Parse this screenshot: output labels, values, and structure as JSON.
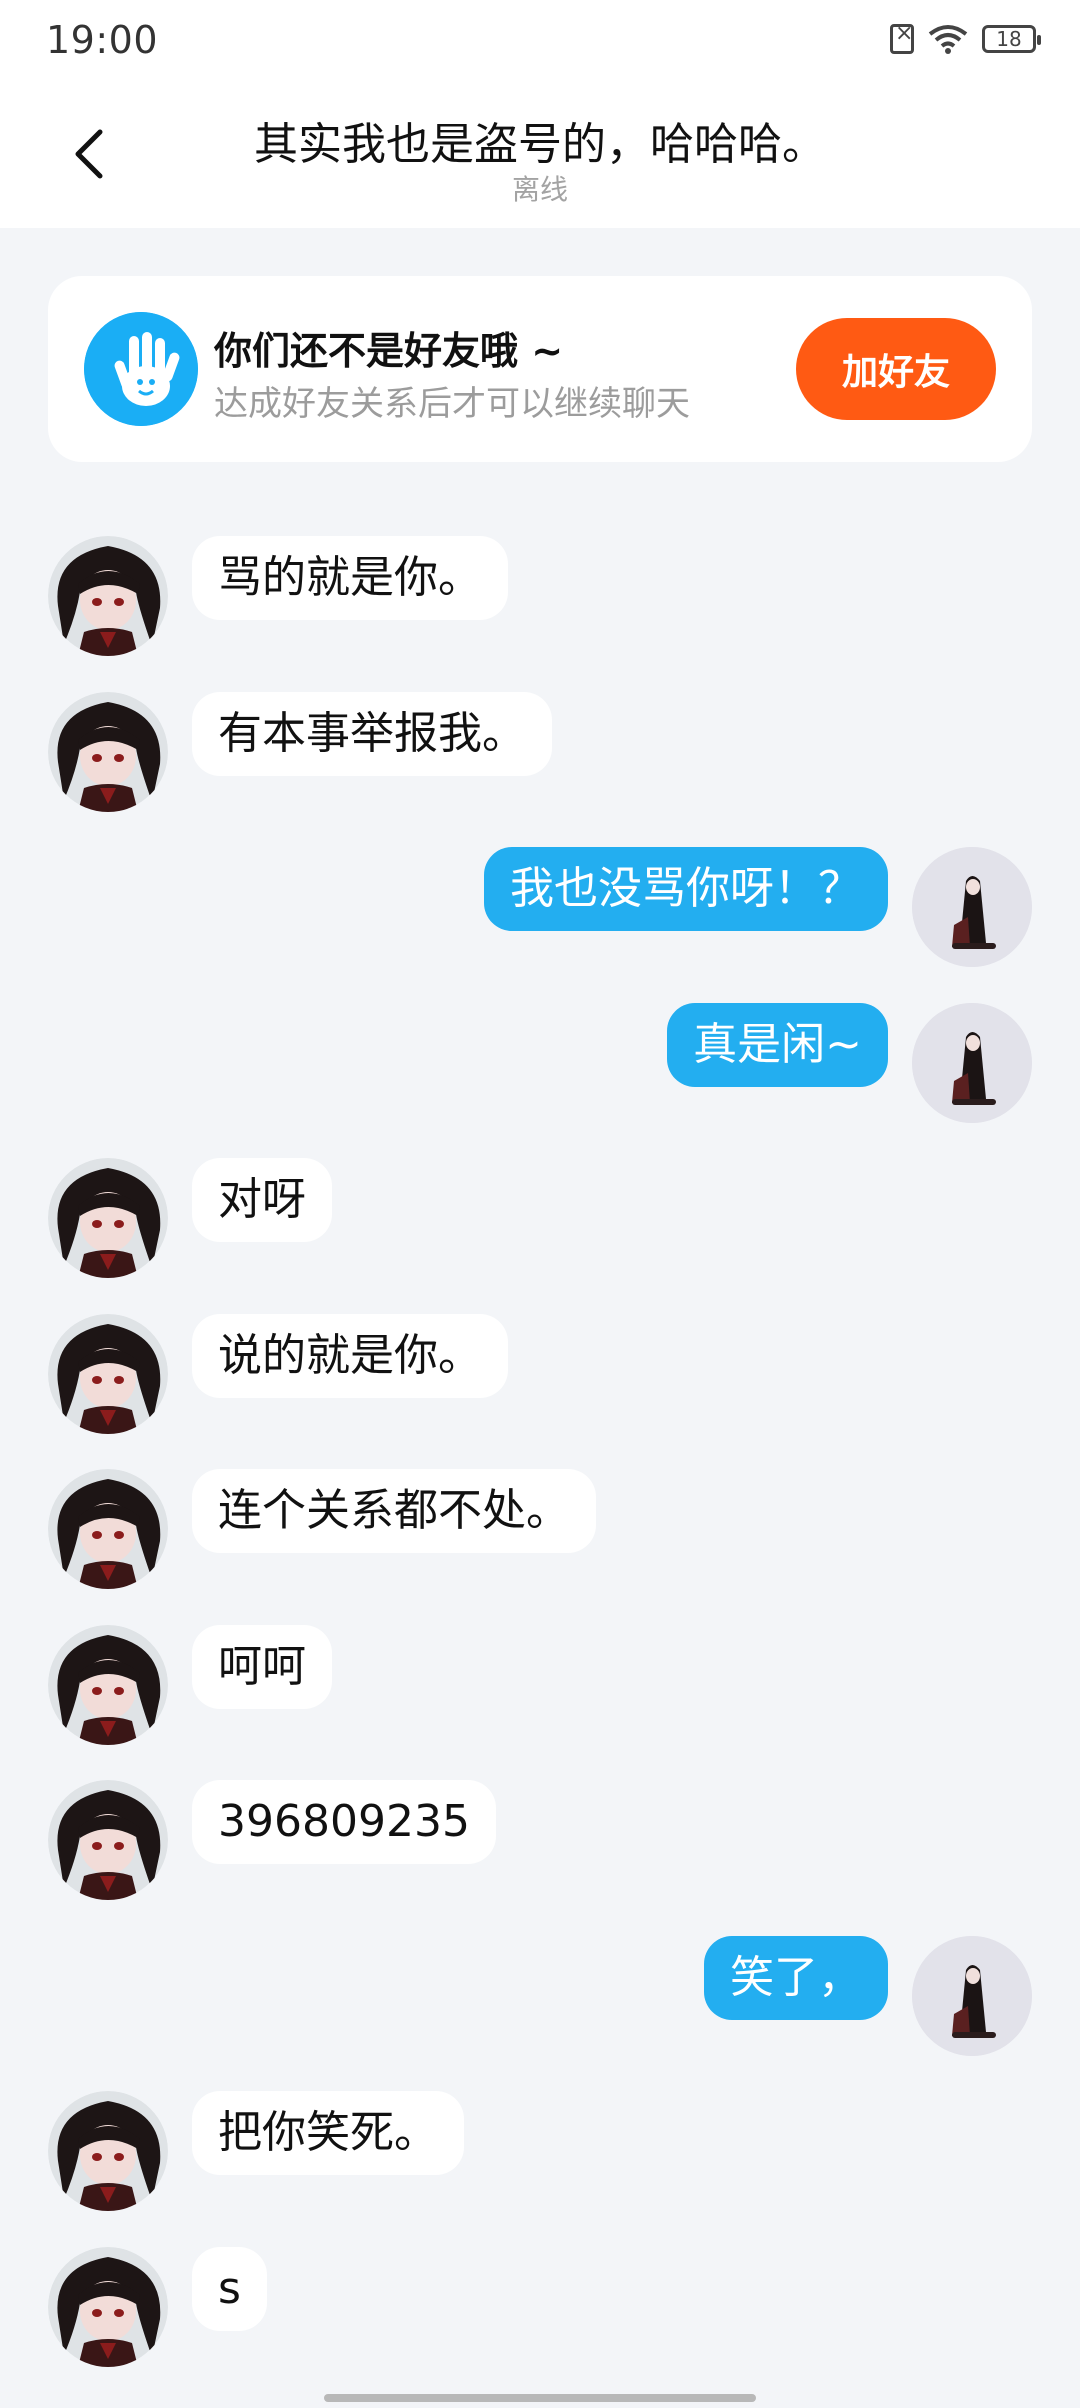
{
  "status_bar": {
    "time": "19:00",
    "battery": "18"
  },
  "header": {
    "title": "其实我也是盗号的，哈哈哈。",
    "subtitle": "离线"
  },
  "friend_banner": {
    "title": "你们还不是好友哦 ~",
    "description": "达成好友关系后才可以继续聊天",
    "button_label": "加好友"
  },
  "messages": [
    {
      "side": "left",
      "text": "骂的就是你。"
    },
    {
      "side": "left",
      "text": "有本事举报我。"
    },
    {
      "side": "right",
      "text": "我也没骂你呀！？"
    },
    {
      "side": "right",
      "text": "真是闲~"
    },
    {
      "side": "left",
      "text": "对呀"
    },
    {
      "side": "left",
      "text": "说的就是你。"
    },
    {
      "side": "left",
      "text": "连个关系都不处。"
    },
    {
      "side": "left",
      "text": "呵呵"
    },
    {
      "side": "left",
      "text": "396809235"
    },
    {
      "side": "right",
      "text": "笑了，"
    },
    {
      "side": "left",
      "text": "把你笑死。"
    },
    {
      "side": "left",
      "text": "s"
    }
  ],
  "colors": {
    "accent_blue": "#23aef0",
    "add_friend_orange": "#ff5a13",
    "background": "#f3f5f8"
  }
}
